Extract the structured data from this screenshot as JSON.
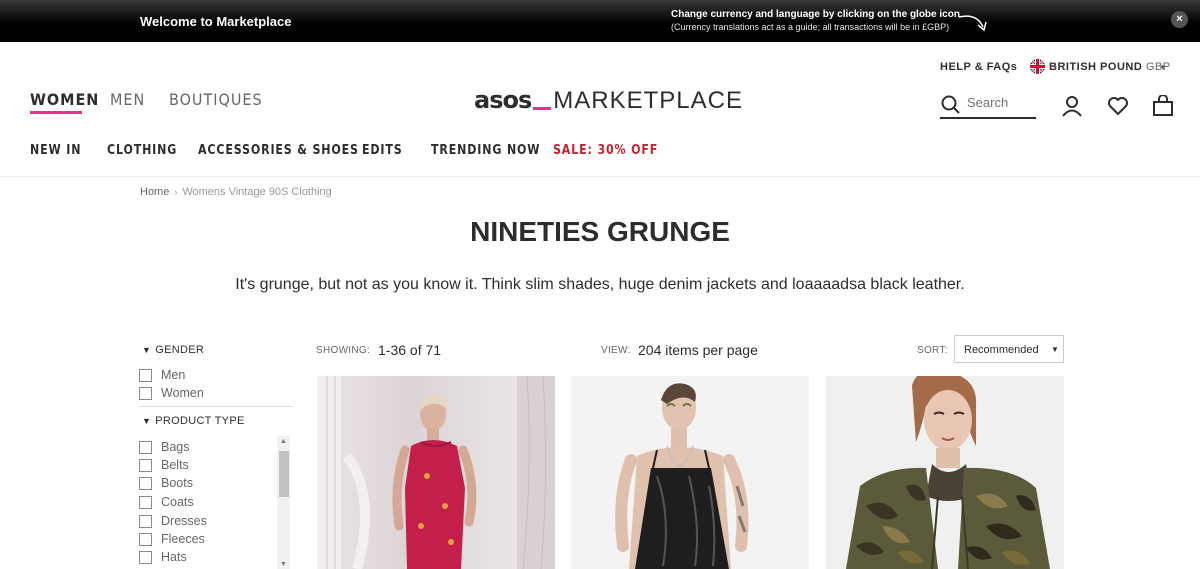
{
  "banner": {
    "welcome": "Welcome to Marketplace",
    "currency_line1": "Change currency and language by clicking on the globe icon",
    "currency_line2": "(Currency translations act as a guide; all transactions will be in £GBP)",
    "close": "×"
  },
  "header": {
    "help": "HELP & FAQs",
    "currency": "BRITISH POUND",
    "currency_code": "GBP",
    "gender_tabs": [
      "WOMEN",
      "MEN",
      "BOUTIQUES"
    ],
    "logo_asos": "asos",
    "logo_marketplace": "MARKETPLACE",
    "search_placeholder": "Search",
    "nav": [
      "NEW IN",
      "CLOTHING",
      "ACCESSORIES & SHOES",
      "EDITS",
      "TRENDING NOW",
      "SALE: 30% OFF"
    ],
    "accent_color": "#e3338e",
    "sale_color": "#c4232f"
  },
  "breadcrumb": {
    "home": "Home",
    "separator": "›",
    "current": "Womens Vintage 90S Clothing"
  },
  "page": {
    "title": "NINETIES GRUNGE",
    "description": "It's grunge, but not as you know it. Think slim shades, huge denim jackets and loaaaadsa black leather."
  },
  "filters": {
    "gender": {
      "heading": "GENDER",
      "options": [
        "Men",
        "Women"
      ]
    },
    "product_type": {
      "heading": "PRODUCT TYPE",
      "options": [
        "Bags",
        "Belts",
        "Boots",
        "Coats",
        "Dresses",
        "Fleeces",
        "Hats"
      ]
    }
  },
  "toolbar": {
    "showing_label": "SHOWING:",
    "showing_value": "1-36 of 71",
    "view_label": "VIEW:",
    "view_value": "204 items per page",
    "sort_label": "SORT:",
    "sort_value": "Recommended"
  },
  "products": [
    {
      "image": "model-red-cheongsam-dress"
    },
    {
      "image": "model-black-vinyl-slip-dress"
    },
    {
      "image": "model-camouflage-jacket"
    }
  ]
}
